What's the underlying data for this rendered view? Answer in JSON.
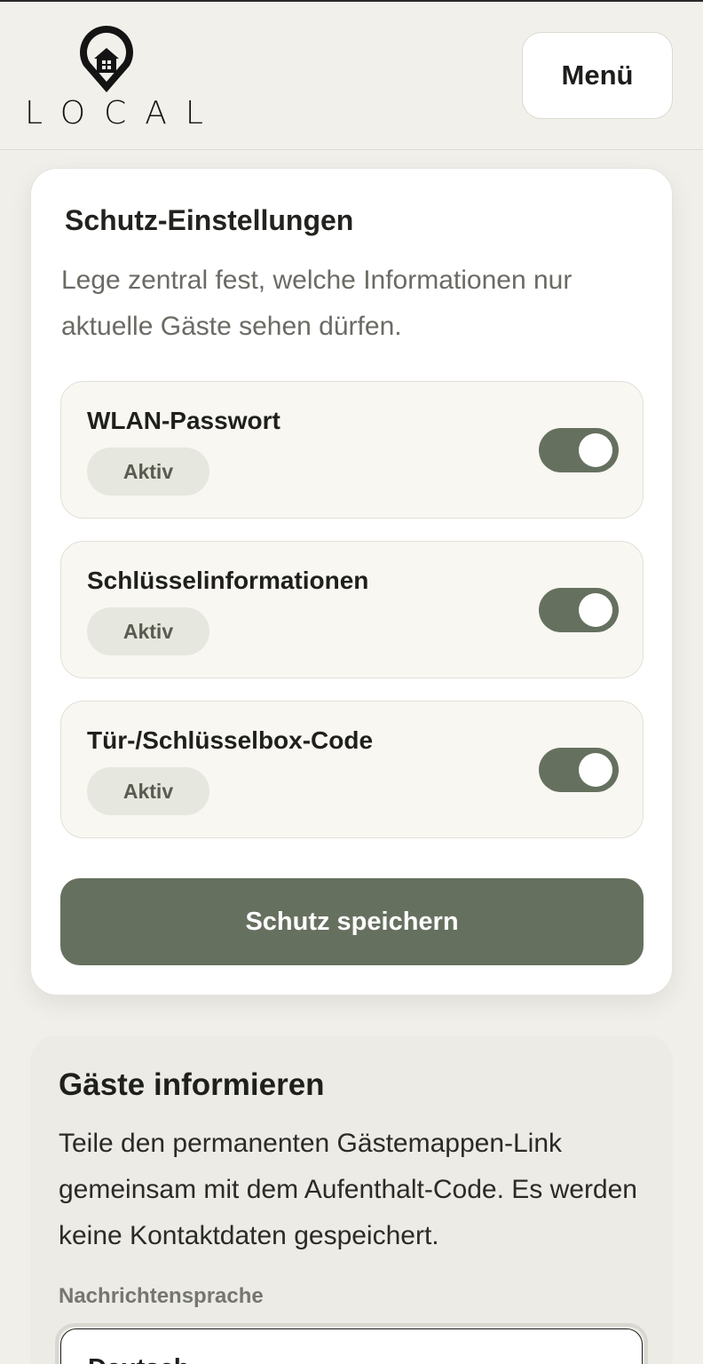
{
  "header": {
    "logo_text": "LOCAL",
    "menu_label": "Menü"
  },
  "protection": {
    "title": "Schutz-Einstellungen",
    "description": "Lege zentral fest, welche Informationen nur aktuelle Gäste sehen dürfen.",
    "items": [
      {
        "label": "WLAN-Passwort",
        "status": "Aktiv",
        "enabled": true
      },
      {
        "label": "Schlüsselinformationen",
        "status": "Aktiv",
        "enabled": true
      },
      {
        "label": "Tür-/Schlüsselbox-Code",
        "status": "Aktiv",
        "enabled": true
      }
    ],
    "save_label": "Schutz speichern"
  },
  "guests": {
    "title": "Gäste informieren",
    "description": "Teile den permanenten Gästemappen-Link gemeinsam mit dem Aufenthalt-Code. Es werden keine Kontaktdaten gespeichert.",
    "language_label": "Nachrichtensprache",
    "language_value": "Deutsch"
  },
  "colors": {
    "accent": "#66705f",
    "background": "#f1efea",
    "badge_bg": "#e6e7df"
  }
}
